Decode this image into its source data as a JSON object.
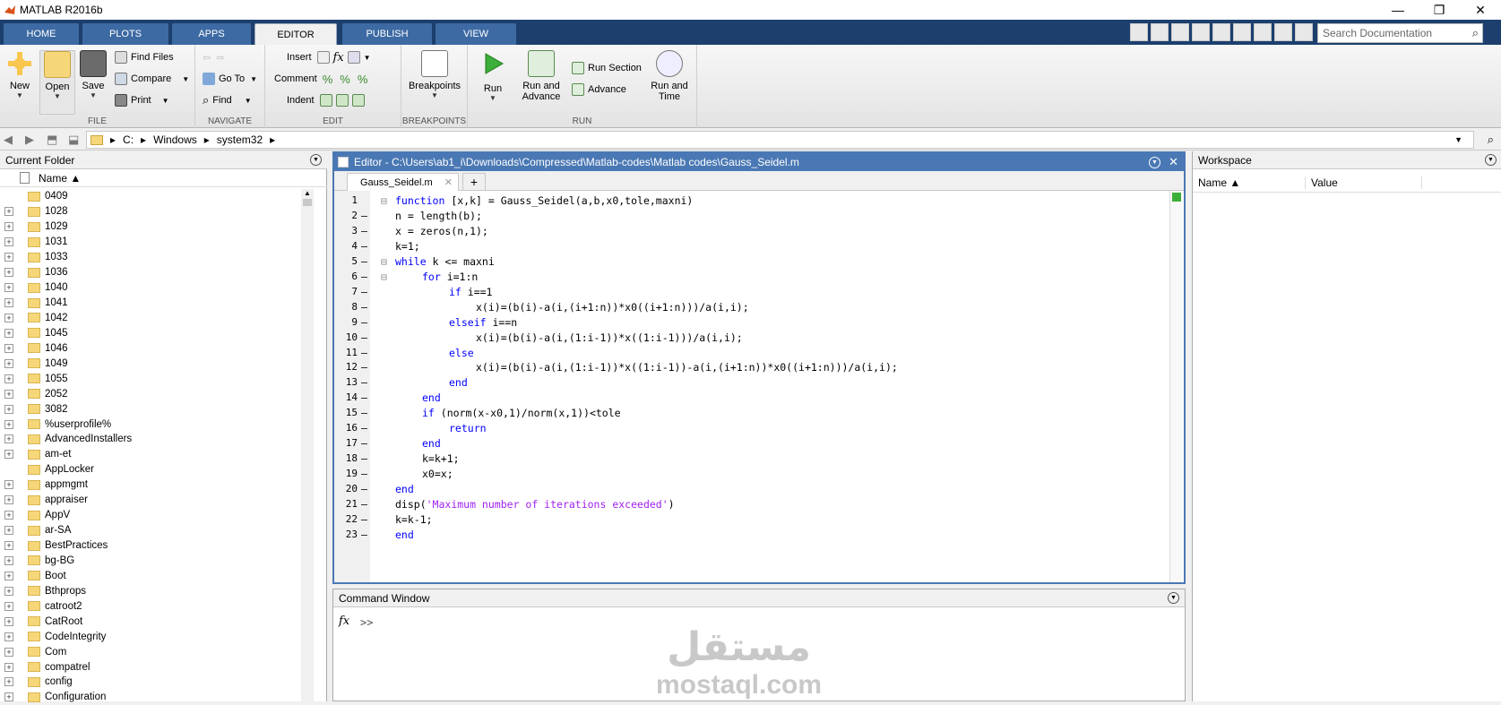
{
  "window": {
    "title": "MATLAB R2016b",
    "minimize": "—",
    "maximize": "❐",
    "close": "✕"
  },
  "tabs": [
    "HOME",
    "PLOTS",
    "APPS",
    "EDITOR",
    "PUBLISH",
    "VIEW"
  ],
  "active_tab": "EDITOR",
  "search": {
    "placeholder": "Search Documentation"
  },
  "ribbon": {
    "file": {
      "label": "FILE",
      "new": "New",
      "open": "Open",
      "save": "Save",
      "find_files": "Find Files",
      "compare": "Compare",
      "print": "Print"
    },
    "navigate": {
      "label": "NAVIGATE",
      "go_to": "Go To",
      "find": "Find"
    },
    "edit": {
      "label": "EDIT",
      "insert": "Insert",
      "comment": "Comment",
      "indent": "Indent"
    },
    "breakpoints": {
      "label": "BREAKPOINTS",
      "breakpoints": "Breakpoints"
    },
    "run": {
      "label": "RUN",
      "run": "Run",
      "run_and_advance": "Run and Advance",
      "run_section": "Run Section",
      "advance": "Advance",
      "run_and_time": "Run and Time"
    }
  },
  "address": {
    "parts": [
      "C:",
      "Windows",
      "system32"
    ]
  },
  "current_folder": {
    "title": "Current Folder",
    "col_name": "Name ▲",
    "items": [
      {
        "name": "0409",
        "exp": false
      },
      {
        "name": "1028",
        "exp": true
      },
      {
        "name": "1029",
        "exp": true
      },
      {
        "name": "1031",
        "exp": true
      },
      {
        "name": "1033",
        "exp": true
      },
      {
        "name": "1036",
        "exp": true
      },
      {
        "name": "1040",
        "exp": true
      },
      {
        "name": "1041",
        "exp": true
      },
      {
        "name": "1042",
        "exp": true
      },
      {
        "name": "1045",
        "exp": true
      },
      {
        "name": "1046",
        "exp": true
      },
      {
        "name": "1049",
        "exp": true
      },
      {
        "name": "1055",
        "exp": true
      },
      {
        "name": "2052",
        "exp": true
      },
      {
        "name": "3082",
        "exp": true
      },
      {
        "name": "%userprofile%",
        "exp": true
      },
      {
        "name": "AdvancedInstallers",
        "exp": true
      },
      {
        "name": "am-et",
        "exp": true
      },
      {
        "name": "AppLocker",
        "exp": false
      },
      {
        "name": "appmgmt",
        "exp": true
      },
      {
        "name": "appraiser",
        "exp": true
      },
      {
        "name": "AppV",
        "exp": true
      },
      {
        "name": "ar-SA",
        "exp": true
      },
      {
        "name": "BestPractices",
        "exp": true
      },
      {
        "name": "bg-BG",
        "exp": true
      },
      {
        "name": "Boot",
        "exp": true
      },
      {
        "name": "Bthprops",
        "exp": true
      },
      {
        "name": "catroot2",
        "exp": true
      },
      {
        "name": "CatRoot",
        "exp": true
      },
      {
        "name": "CodeIntegrity",
        "exp": true
      },
      {
        "name": "Com",
        "exp": true
      },
      {
        "name": "compatrel",
        "exp": true
      },
      {
        "name": "config",
        "exp": true
      },
      {
        "name": "Configuration",
        "exp": true
      }
    ]
  },
  "editor": {
    "title": "Editor - C:\\Users\\ab1_i\\Downloads\\Compressed\\Matlab-codes\\Matlab codes\\Gauss_Seidel.m",
    "tab_name": "Gauss_Seidel.m",
    "lines": [
      {
        "n": "1",
        "dash": "",
        "fold": "⊟",
        "indent": 0,
        "parts": [
          [
            "kw",
            "function"
          ],
          [
            "t",
            " [x,k] = Gauss_Seidel(a,b,x0,tole,maxni)"
          ]
        ]
      },
      {
        "n": "2",
        "dash": "–",
        "fold": "",
        "indent": 0,
        "parts": [
          [
            "t",
            "n = length(b);"
          ]
        ]
      },
      {
        "n": "3",
        "dash": "–",
        "fold": "",
        "indent": 0,
        "parts": [
          [
            "t",
            "x = zeros(n,1);"
          ]
        ]
      },
      {
        "n": "4",
        "dash": "–",
        "fold": "",
        "indent": 0,
        "parts": [
          [
            "t",
            "k=1;"
          ]
        ]
      },
      {
        "n": "5",
        "dash": "–",
        "fold": "⊟",
        "indent": 0,
        "parts": [
          [
            "kw",
            "while"
          ],
          [
            "t",
            " k <= maxni"
          ]
        ]
      },
      {
        "n": "6",
        "dash": "–",
        "fold": "⊟",
        "indent": 1,
        "parts": [
          [
            "kw",
            "for"
          ],
          [
            "t",
            " i=1:n"
          ]
        ]
      },
      {
        "n": "7",
        "dash": "–",
        "fold": "",
        "indent": 2,
        "parts": [
          [
            "kw",
            "if"
          ],
          [
            "t",
            " i==1"
          ]
        ]
      },
      {
        "n": "8",
        "dash": "–",
        "fold": "",
        "indent": 3,
        "parts": [
          [
            "t",
            "x(i)=(b(i)-a(i,(i+1:n))*x0((i+1:n)))/a(i,i);"
          ]
        ]
      },
      {
        "n": "9",
        "dash": "–",
        "fold": "",
        "indent": 2,
        "parts": [
          [
            "kw",
            "elseif"
          ],
          [
            "t",
            " i==n"
          ]
        ]
      },
      {
        "n": "10",
        "dash": "–",
        "fold": "",
        "indent": 3,
        "parts": [
          [
            "t",
            "x(i)=(b(i)-a(i,(1:i-1))*x((1:i-1)))/a(i,i);"
          ]
        ]
      },
      {
        "n": "11",
        "dash": "–",
        "fold": "",
        "indent": 2,
        "parts": [
          [
            "kw",
            "else"
          ]
        ]
      },
      {
        "n": "12",
        "dash": "–",
        "fold": "",
        "indent": 3,
        "parts": [
          [
            "t",
            "x(i)=(b(i)-a(i,(1:i-1))*x((1:i-1))-a(i,(i+1:n))*x0((i+1:n)))/a(i,i);"
          ]
        ]
      },
      {
        "n": "13",
        "dash": "–",
        "fold": "",
        "indent": 2,
        "parts": [
          [
            "kw",
            "end"
          ]
        ]
      },
      {
        "n": "14",
        "dash": "–",
        "fold": "",
        "indent": 1,
        "parts": [
          [
            "kw",
            "end"
          ]
        ]
      },
      {
        "n": "15",
        "dash": "–",
        "fold": "",
        "indent": 1,
        "parts": [
          [
            "kw",
            "if"
          ],
          [
            "t",
            " (norm(x-x0,1)/norm(x,1))<tole"
          ]
        ]
      },
      {
        "n": "16",
        "dash": "–",
        "fold": "",
        "indent": 2,
        "parts": [
          [
            "kw",
            "return"
          ]
        ]
      },
      {
        "n": "17",
        "dash": "–",
        "fold": "",
        "indent": 1,
        "parts": [
          [
            "kw",
            "end"
          ]
        ]
      },
      {
        "n": "18",
        "dash": "–",
        "fold": "",
        "indent": 1,
        "parts": [
          [
            "t",
            "k=k+1;"
          ]
        ]
      },
      {
        "n": "19",
        "dash": "–",
        "fold": "",
        "indent": 1,
        "parts": [
          [
            "t",
            "x0=x;"
          ]
        ]
      },
      {
        "n": "20",
        "dash": "–",
        "fold": "",
        "indent": 0,
        "parts": [
          [
            "kw",
            "end"
          ]
        ]
      },
      {
        "n": "21",
        "dash": "–",
        "fold": "",
        "indent": 0,
        "parts": [
          [
            "t",
            "disp("
          ],
          [
            "st",
            "'Maximum number of iterations exceeded'"
          ],
          [
            "t",
            ")"
          ]
        ]
      },
      {
        "n": "22",
        "dash": "–",
        "fold": "",
        "indent": 0,
        "parts": [
          [
            "t",
            "k=k-1;"
          ]
        ]
      },
      {
        "n": "23",
        "dash": "–",
        "fold": "",
        "indent": 0,
        "parts": [
          [
            "kw",
            "end"
          ]
        ]
      }
    ]
  },
  "command_window": {
    "title": "Command Window",
    "fx": "fx",
    "prompt": ">>",
    "watermark_arabic": "مستقل",
    "watermark_domain": "mostaql.com"
  },
  "workspace": {
    "title": "Workspace",
    "col_name": "Name ▲",
    "col_value": "Value"
  },
  "colors": {
    "accent": "#4a78b4",
    "tabstrip": "#1c3f6e",
    "keyword": "#0000ff",
    "string": "#a020f0"
  }
}
